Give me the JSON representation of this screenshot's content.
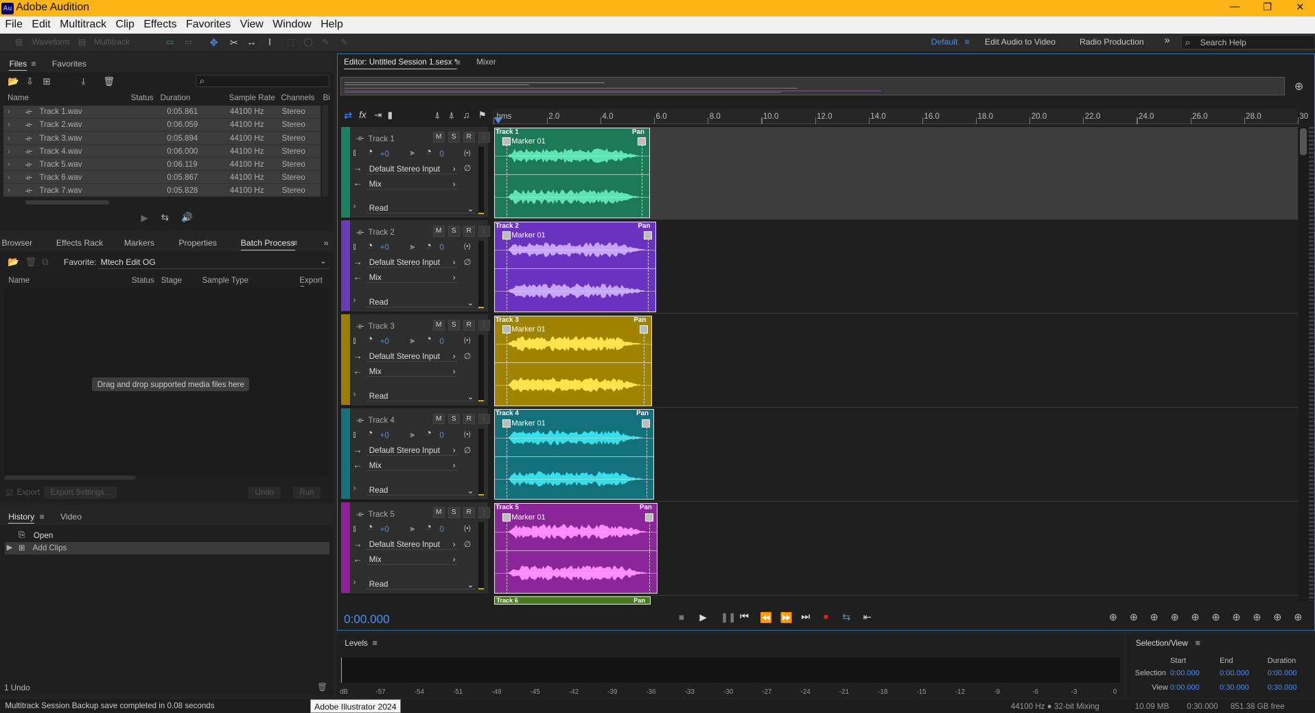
{
  "app": {
    "title": "Adobe Audition",
    "logo": "Au"
  },
  "menu": [
    "File",
    "Edit",
    "Multitrack",
    "Clip",
    "Effects",
    "Favorites",
    "View",
    "Window",
    "Help"
  ],
  "toolbar": {
    "waveform": "Waveform",
    "multitrack": "Multitrack"
  },
  "workspaces": {
    "default": "Default",
    "edit_video": "Edit Audio to Video",
    "radio": "Radio Production",
    "search_placeholder": "Search Help"
  },
  "files": {
    "tab_files": "Files",
    "tab_favorites": "Favorites",
    "columns": [
      "Name",
      "Status",
      "Duration",
      "Sample Rate",
      "Channels",
      "Bi"
    ],
    "rows": [
      {
        "name": "Track 1.wav",
        "duration": "0:05.861",
        "rate": "44100 Hz",
        "channels": "Stereo"
      },
      {
        "name": "Track 2.wav",
        "duration": "0:06.059",
        "rate": "44100 Hz",
        "channels": "Stereo"
      },
      {
        "name": "Track 3.wav",
        "duration": "0:05.894",
        "rate": "44100 Hz",
        "channels": "Stereo"
      },
      {
        "name": "Track 4.wav",
        "duration": "0:06.000",
        "rate": "44100 Hz",
        "channels": "Stereo"
      },
      {
        "name": "Track 5.wav",
        "duration": "0:06.119",
        "rate": "44100 Hz",
        "channels": "Stereo"
      },
      {
        "name": "Track 6.wav",
        "duration": "0:05.867",
        "rate": "44100 Hz",
        "channels": "Stereo"
      },
      {
        "name": "Track 7.wav",
        "duration": "0:05.828",
        "rate": "44100 Hz",
        "channels": "Stereo"
      }
    ]
  },
  "batch": {
    "tabs": [
      "Browser",
      "Effects Rack",
      "Markers",
      "Properties",
      "Batch Process"
    ],
    "favorite_label": "Favorite:",
    "favorite_value": "Mtech Edit OG",
    "columns": [
      "Name",
      "Status",
      "Stage",
      "Sample Type",
      "Export Sa"
    ],
    "empty": "Drag and drop supported media files here",
    "export": "Export",
    "export_settings": "Export Settings...",
    "undo": "Undo",
    "run": "Run"
  },
  "history": {
    "tab_history": "History",
    "tab_video": "Video",
    "items": [
      "Open",
      "Add Clips"
    ],
    "undo_count": "1 Undo"
  },
  "status": {
    "message": "Multitrack Session Backup save completed in 0.08 seconds",
    "tooltip": "Adobe Illustrator 2024",
    "format": "44100 Hz ● 32-bit Mixing",
    "size": "10.09 MB",
    "duration": "0:30.000",
    "free": "851.38 GB free"
  },
  "editor": {
    "tab": "Editor: Untitled Session 1.sesx *",
    "mixer": "Mixer",
    "time": "0:00.000",
    "ruler": [
      "hms",
      "2.0",
      "4.0",
      "6.0",
      "8.0",
      "10.0",
      "12.0",
      "14.0",
      "16.0",
      "18.0",
      "20.0",
      "22.0",
      "24.0",
      "26.0",
      "28.0",
      "30"
    ]
  },
  "tracks": [
    {
      "name": "Track 1",
      "vol": "+0",
      "pan": "0",
      "input": "Default Stereo Input",
      "output": "Mix",
      "mode": "Read",
      "color": "#1e8060",
      "wave": "#5fe3b4",
      "clip": "#1d7a58"
    },
    {
      "name": "Track 2",
      "vol": "+0",
      "pan": "0",
      "input": "Default Stereo Input",
      "output": "Mix",
      "mode": "Read",
      "color": "#6a3bb5",
      "wave": "#c7a6ff",
      "clip": "#6a32c0"
    },
    {
      "name": "Track 3",
      "vol": "+0",
      "pan": "0",
      "input": "Default Stereo Input",
      "output": "Mix",
      "mode": "Read",
      "color": "#9a7f00",
      "wave": "#ffe34a",
      "clip": "#a08400"
    },
    {
      "name": "Track 4",
      "vol": "+0",
      "pan": "0",
      "input": "Default Stereo Input",
      "output": "Mix",
      "mode": "Read",
      "color": "#17707a",
      "wave": "#35e0ea",
      "clip": "#13717b"
    },
    {
      "name": "Track 5",
      "vol": "+0",
      "pan": "0",
      "input": "Default Stereo Input",
      "output": "Mix",
      "mode": "Read",
      "color": "#8a2395",
      "wave": "#ff8dff",
      "clip": "#8a2699"
    }
  ],
  "clip_labels": {
    "pan": "Pan",
    "marker": "Marker 01",
    "track6": "Track 6",
    "msr": [
      "M",
      "S",
      "R"
    ]
  },
  "levels": {
    "title": "Levels",
    "scale": [
      "dB",
      "-57",
      "-54",
      "-51",
      "-48",
      "-45",
      "-42",
      "-39",
      "-36",
      "-33",
      "-30",
      "-27",
      "-24",
      "-21",
      "-18",
      "-15",
      "-12",
      "-9",
      "-6",
      "-3",
      "0"
    ]
  },
  "selection": {
    "title": "Selection/View",
    "col_start": "Start",
    "col_end": "End",
    "col_duration": "Duration",
    "sel_label": "Selection",
    "sel_start": "0:00.000",
    "sel_end": "0:00.000",
    "sel_dur": "0:00.000",
    "view_label": "View",
    "view_start": "0:00.000",
    "view_end": "0:30.000",
    "view_dur": "0:30.000"
  }
}
